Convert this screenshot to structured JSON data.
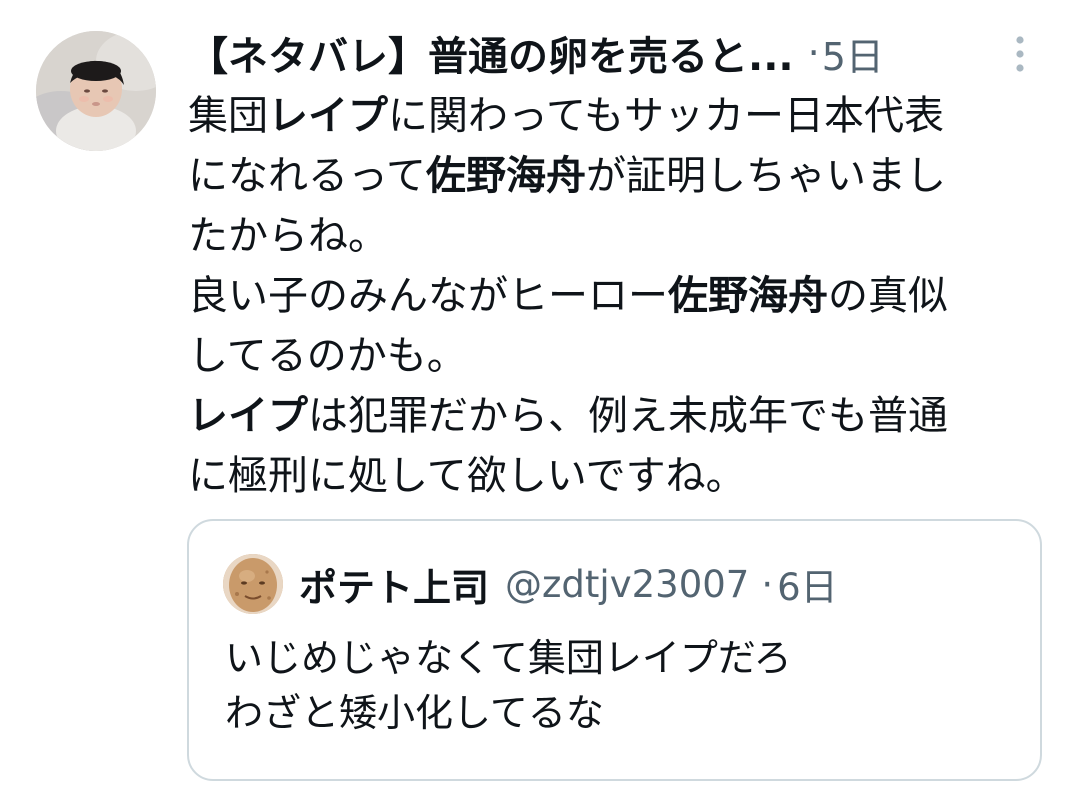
{
  "tweet": {
    "display_name": "【ネタバレ】普通の卵を売ると...",
    "separator": "·",
    "time": "5日",
    "more_icon": "more-vertical-icon",
    "text_lines": [
      {
        "segments": [
          {
            "text": "集団",
            "bold": false
          },
          {
            "text": "レイプ",
            "bold": true
          },
          {
            "text": "に関わってもサッカー日本代表",
            "bold": false
          }
        ]
      },
      {
        "segments": [
          {
            "text": "になれるって",
            "bold": false
          },
          {
            "text": "佐野海舟",
            "bold": true
          },
          {
            "text": "が証明しちゃいまし",
            "bold": false
          }
        ]
      },
      {
        "segments": [
          {
            "text": "たからね。",
            "bold": false
          }
        ]
      },
      {
        "segments": [
          {
            "text": "良い子のみんながヒーロー",
            "bold": false
          },
          {
            "text": "佐野海舟",
            "bold": true
          },
          {
            "text": "の真似",
            "bold": false
          }
        ]
      },
      {
        "segments": [
          {
            "text": "してるのかも。",
            "bold": false
          }
        ]
      },
      {
        "segments": [
          {
            "text": "レイプ",
            "bold": true
          },
          {
            "text": "は犯罪だから、例え未成年でも普通",
            "bold": false
          }
        ]
      },
      {
        "segments": [
          {
            "text": "に極刑に処して欲しいですね。",
            "bold": false
          }
        ]
      }
    ]
  },
  "quote": {
    "display_name": "ポテト上司",
    "handle": "@zdtjv23007",
    "separator": "·",
    "time": "6日",
    "text_lines": [
      "いじめじゃなくて集団レイプだろ",
      "わざと矮小化してるな"
    ]
  },
  "colors": {
    "text": "#0f1419",
    "secondary": "#536471",
    "border": "#cfd9de",
    "more_icon": "#aab8c2"
  }
}
